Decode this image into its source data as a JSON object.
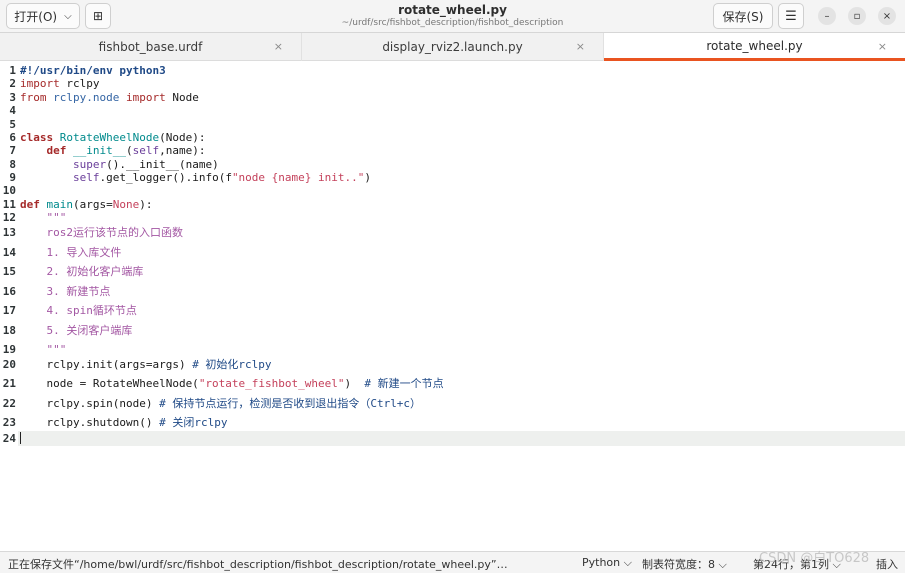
{
  "header": {
    "open_label": "打开(O)",
    "open_chevron": "⌵",
    "newdoc_icon": "⊞",
    "title": "rotate_wheel.py",
    "subtitle": "~/urdf/src/fishbot_description/fishbot_description",
    "save_label": "保存(S)",
    "menu_icon": "☰",
    "min_icon": "–",
    "max_icon": "▫",
    "close_icon": "×"
  },
  "tabs": [
    {
      "label": "fishbot_base.urdf",
      "close": "×"
    },
    {
      "label": "display_rviz2.launch.py",
      "close": "×"
    },
    {
      "label": "rotate_wheel.py",
      "close": "×"
    }
  ],
  "line_numbers": [
    "1",
    "2",
    "3",
    "4",
    "5",
    "6",
    "7",
    "8",
    "9",
    "10",
    "11",
    "12",
    "13",
    "14",
    "15",
    "16",
    "17",
    "18",
    "19",
    "20",
    "21",
    "22",
    "23",
    "24"
  ],
  "code": [
    [
      {
        "t": "#!/usr/bin/env python3",
        "c": "sh"
      }
    ],
    [
      {
        "t": "import",
        "c": "kw2"
      },
      {
        "t": " rclpy",
        "c": ""
      }
    ],
    [
      {
        "t": "from",
        "c": "kw2"
      },
      {
        "t": " rclpy.node ",
        "c": "mod"
      },
      {
        "t": "import",
        "c": "kw2"
      },
      {
        "t": " Node",
        "c": ""
      }
    ],
    [],
    [],
    [
      {
        "t": "class",
        "c": "kw"
      },
      {
        "t": " ",
        "c": ""
      },
      {
        "t": "RotateWheelNode",
        "c": "fn"
      },
      {
        "t": "(Node):",
        "c": ""
      }
    ],
    [
      {
        "t": "    ",
        "c": ""
      },
      {
        "t": "def",
        "c": "kw"
      },
      {
        "t": " ",
        "c": ""
      },
      {
        "t": "__init__",
        "c": "fn"
      },
      {
        "t": "(",
        "c": ""
      },
      {
        "t": "self",
        "c": "self"
      },
      {
        "t": ",name):",
        "c": ""
      }
    ],
    [
      {
        "t": "        ",
        "c": ""
      },
      {
        "t": "super",
        "c": "bi"
      },
      {
        "t": "().__init__(name)",
        "c": ""
      }
    ],
    [
      {
        "t": "        ",
        "c": ""
      },
      {
        "t": "self",
        "c": "self"
      },
      {
        "t": ".get_logger().info(f",
        "c": ""
      },
      {
        "t": "\"node {name} init..\"",
        "c": "str"
      },
      {
        "t": ")",
        "c": ""
      }
    ],
    [],
    [
      {
        "t": "def",
        "c": "kw"
      },
      {
        "t": " ",
        "c": ""
      },
      {
        "t": "main",
        "c": "fn"
      },
      {
        "t": "(args=",
        "c": ""
      },
      {
        "t": "None",
        "c": "str"
      },
      {
        "t": "):",
        "c": ""
      }
    ],
    [
      {
        "t": "    \"\"\"",
        "c": "doc"
      }
    ],
    [
      {
        "t": "    ros2运行该节点的入口函数",
        "c": "doc"
      }
    ],
    [
      {
        "t": "    1. 导入库文件",
        "c": "doc"
      }
    ],
    [
      {
        "t": "    2. 初始化客户端库",
        "c": "doc"
      }
    ],
    [
      {
        "t": "    3. 新建节点",
        "c": "doc"
      }
    ],
    [
      {
        "t": "    4. spin循环节点",
        "c": "doc"
      }
    ],
    [
      {
        "t": "    5. 关闭客户端库",
        "c": "doc"
      }
    ],
    [
      {
        "t": "    \"\"\"",
        "c": "doc"
      }
    ],
    [
      {
        "t": "    rclpy.init(args=args) ",
        "c": ""
      },
      {
        "t": "# 初始化rclpy",
        "c": "cmt"
      }
    ],
    [
      {
        "t": "    node = RotateWheelNode(",
        "c": ""
      },
      {
        "t": "\"rotate_fishbot_wheel\"",
        "c": "str"
      },
      {
        "t": ")  ",
        "c": ""
      },
      {
        "t": "# 新建一个节点",
        "c": "cmt"
      }
    ],
    [
      {
        "t": "    rclpy.spin(node) ",
        "c": ""
      },
      {
        "t": "# 保持节点运行，检测是否收到退出指令（Ctrl+c）",
        "c": "cmt"
      }
    ],
    [
      {
        "t": "    rclpy.shutdown() ",
        "c": ""
      },
      {
        "t": "# 关闭rclpy",
        "c": "cmt"
      }
    ],
    []
  ],
  "status": {
    "message": "正在保存文件“/home/bwl/urdf/src/fishbot_description/fishbot_description/rotate_wheel.py”…",
    "language": "Python ⌵",
    "tab_width": "制表符宽度：8 ⌵",
    "position": "第24行，第1列 ⌵",
    "mode": "插入"
  },
  "watermark": "CSDN @白TO628"
}
